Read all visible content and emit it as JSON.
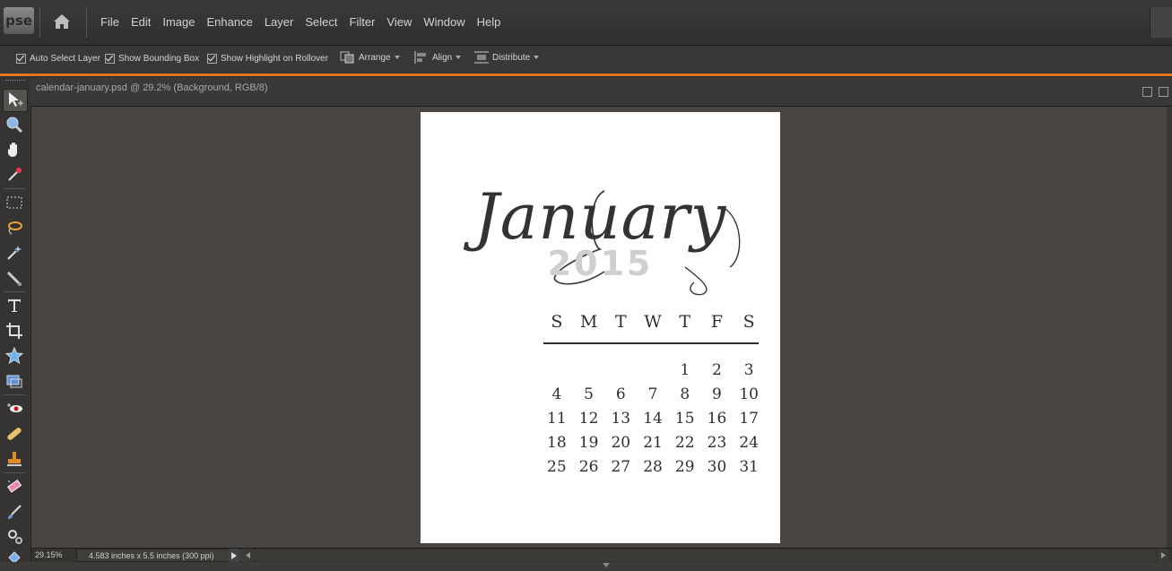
{
  "app": {
    "logo_text": "pse"
  },
  "menu": [
    "File",
    "Edit",
    "Image",
    "Enhance",
    "Layer",
    "Select",
    "Filter",
    "View",
    "Window",
    "Help"
  ],
  "options": {
    "auto_select_layer": {
      "label": "Auto Select Layer",
      "checked": true
    },
    "show_bounding_box": {
      "label": "Show Bounding Box",
      "checked": true
    },
    "show_highlight": {
      "label": "Show Highlight on Rollover",
      "checked": true
    },
    "arrange": "Arrange",
    "align": "Align",
    "distribute": "Distribute"
  },
  "document": {
    "tab_title": "calendar-january.psd @ 29.2% (Background, RGB/8)"
  },
  "calendar": {
    "month": "January",
    "year": "2015",
    "weekdays": [
      "S",
      "M",
      "T",
      "W",
      "T",
      "F",
      "S"
    ],
    "weeks": [
      [
        "",
        "",
        "",
        "",
        "1",
        "2",
        "3"
      ],
      [
        "4",
        "5",
        "6",
        "7",
        "8",
        "9",
        "10"
      ],
      [
        "11",
        "12",
        "13",
        "14",
        "15",
        "16",
        "17"
      ],
      [
        "18",
        "19",
        "20",
        "21",
        "22",
        "23",
        "24"
      ],
      [
        "25",
        "26",
        "27",
        "28",
        "29",
        "30",
        "31"
      ]
    ]
  },
  "status": {
    "zoom": "29.15%",
    "doc_size": "4.583 inches x 5.5 inches (300 ppi)"
  },
  "colors": {
    "accent": "#e2751f",
    "canvas_bg": "#484542"
  }
}
